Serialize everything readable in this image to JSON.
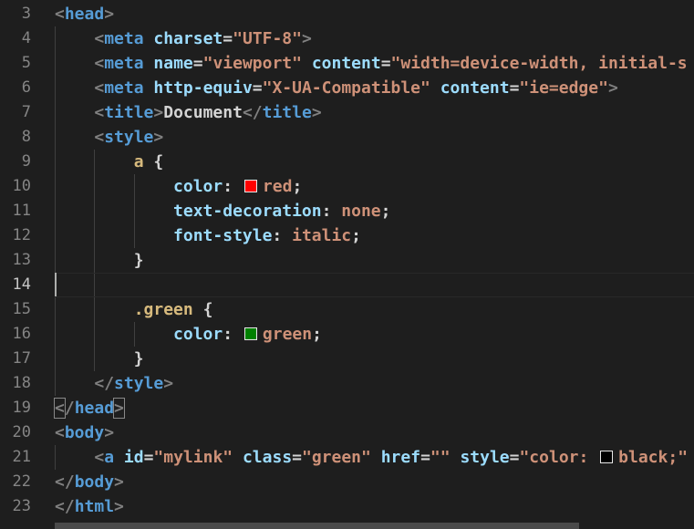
{
  "editor": {
    "lines": [
      {
        "no": "3",
        "code": [
          {
            "t": "punc",
            "v": "<"
          },
          {
            "t": "tag",
            "v": "head"
          },
          {
            "t": "punc",
            "v": ">"
          }
        ]
      },
      {
        "no": "4",
        "code": [
          {
            "t": "text",
            "v": "    "
          },
          {
            "t": "punc",
            "v": "<"
          },
          {
            "t": "tag",
            "v": "meta"
          },
          {
            "t": "text",
            "v": " "
          },
          {
            "t": "attr",
            "v": "charset"
          },
          {
            "t": "text",
            "v": "="
          },
          {
            "t": "str",
            "v": "\"UTF-8\""
          },
          {
            "t": "punc",
            "v": ">"
          }
        ]
      },
      {
        "no": "5",
        "code": [
          {
            "t": "text",
            "v": "    "
          },
          {
            "t": "punc",
            "v": "<"
          },
          {
            "t": "tag",
            "v": "meta"
          },
          {
            "t": "text",
            "v": " "
          },
          {
            "t": "attr",
            "v": "name"
          },
          {
            "t": "text",
            "v": "="
          },
          {
            "t": "str",
            "v": "\"viewport\""
          },
          {
            "t": "text",
            "v": " "
          },
          {
            "t": "attr",
            "v": "content"
          },
          {
            "t": "text",
            "v": "="
          },
          {
            "t": "str",
            "v": "\"width=device-width, initial-s"
          }
        ]
      },
      {
        "no": "6",
        "code": [
          {
            "t": "text",
            "v": "    "
          },
          {
            "t": "punc",
            "v": "<"
          },
          {
            "t": "tag",
            "v": "meta"
          },
          {
            "t": "text",
            "v": " "
          },
          {
            "t": "attr",
            "v": "http-equiv"
          },
          {
            "t": "text",
            "v": "="
          },
          {
            "t": "str",
            "v": "\"X-UA-Compatible\""
          },
          {
            "t": "text",
            "v": " "
          },
          {
            "t": "attr",
            "v": "content"
          },
          {
            "t": "text",
            "v": "="
          },
          {
            "t": "str",
            "v": "\"ie=edge\""
          },
          {
            "t": "punc",
            "v": ">"
          }
        ]
      },
      {
        "no": "7",
        "code": [
          {
            "t": "text",
            "v": "    "
          },
          {
            "t": "punc",
            "v": "<"
          },
          {
            "t": "tag",
            "v": "title"
          },
          {
            "t": "punc",
            "v": ">"
          },
          {
            "t": "text",
            "v": "Document"
          },
          {
            "t": "punc",
            "v": "</"
          },
          {
            "t": "tag",
            "v": "title"
          },
          {
            "t": "punc",
            "v": ">"
          }
        ]
      },
      {
        "no": "8",
        "code": [
          {
            "t": "text",
            "v": "    "
          },
          {
            "t": "punc",
            "v": "<"
          },
          {
            "t": "tag",
            "v": "style"
          },
          {
            "t": "punc",
            "v": ">"
          }
        ]
      },
      {
        "no": "9",
        "code": [
          {
            "t": "text",
            "v": "        "
          },
          {
            "t": "sel",
            "v": "a"
          },
          {
            "t": "text",
            "v": " {"
          }
        ]
      },
      {
        "no": "10",
        "code": [
          {
            "t": "text",
            "v": "            "
          },
          {
            "t": "prop",
            "v": "color"
          },
          {
            "t": "text",
            "v": ": "
          },
          {
            "t": "swatch",
            "v": "#ff0000"
          },
          {
            "t": "val",
            "v": "red"
          },
          {
            "t": "text",
            "v": ";"
          }
        ]
      },
      {
        "no": "11",
        "code": [
          {
            "t": "text",
            "v": "            "
          },
          {
            "t": "prop",
            "v": "text-decoration"
          },
          {
            "t": "text",
            "v": ": "
          },
          {
            "t": "val",
            "v": "none"
          },
          {
            "t": "text",
            "v": ";"
          }
        ]
      },
      {
        "no": "12",
        "code": [
          {
            "t": "text",
            "v": "            "
          },
          {
            "t": "prop",
            "v": "font-style"
          },
          {
            "t": "text",
            "v": ": "
          },
          {
            "t": "val",
            "v": "italic"
          },
          {
            "t": "text",
            "v": ";"
          }
        ]
      },
      {
        "no": "13",
        "code": [
          {
            "t": "text",
            "v": "        }"
          }
        ]
      },
      {
        "no": "14",
        "code": []
      },
      {
        "no": "15",
        "code": [
          {
            "t": "text",
            "v": "        "
          },
          {
            "t": "sel",
            "v": ".green"
          },
          {
            "t": "text",
            "v": " {"
          }
        ]
      },
      {
        "no": "16",
        "code": [
          {
            "t": "text",
            "v": "            "
          },
          {
            "t": "prop",
            "v": "color"
          },
          {
            "t": "text",
            "v": ": "
          },
          {
            "t": "swatch",
            "v": "#008000"
          },
          {
            "t": "val",
            "v": "green"
          },
          {
            "t": "text",
            "v": ";"
          }
        ]
      },
      {
        "no": "17",
        "code": [
          {
            "t": "text",
            "v": "        }"
          }
        ]
      },
      {
        "no": "18",
        "code": [
          {
            "t": "text",
            "v": "    "
          },
          {
            "t": "punc",
            "v": "</"
          },
          {
            "t": "tag",
            "v": "style"
          },
          {
            "t": "punc",
            "v": ">"
          }
        ]
      },
      {
        "no": "19",
        "code": [
          {
            "t": "punc",
            "v": "<",
            "match": true
          },
          {
            "t": "punc",
            "v": "/"
          },
          {
            "t": "tag",
            "v": "head"
          },
          {
            "t": "punc",
            "v": ">",
            "match": true
          }
        ]
      },
      {
        "no": "20",
        "code": [
          {
            "t": "punc",
            "v": "<"
          },
          {
            "t": "tag",
            "v": "body"
          },
          {
            "t": "punc",
            "v": ">"
          }
        ]
      },
      {
        "no": "21",
        "code": [
          {
            "t": "text",
            "v": "    "
          },
          {
            "t": "punc",
            "v": "<"
          },
          {
            "t": "tag",
            "v": "a"
          },
          {
            "t": "text",
            "v": " "
          },
          {
            "t": "attr",
            "v": "id"
          },
          {
            "t": "text",
            "v": "="
          },
          {
            "t": "str",
            "v": "\"mylink\""
          },
          {
            "t": "text",
            "v": " "
          },
          {
            "t": "attr",
            "v": "class"
          },
          {
            "t": "text",
            "v": "="
          },
          {
            "t": "str",
            "v": "\"green\""
          },
          {
            "t": "text",
            "v": " "
          },
          {
            "t": "attr",
            "v": "href"
          },
          {
            "t": "text",
            "v": "="
          },
          {
            "t": "str",
            "v": "\"\""
          },
          {
            "t": "text",
            "v": " "
          },
          {
            "t": "attr",
            "v": "style"
          },
          {
            "t": "text",
            "v": "="
          },
          {
            "t": "str",
            "v": "\"color: "
          },
          {
            "t": "swatch",
            "v": "#000000"
          },
          {
            "t": "str",
            "v": "black;\""
          }
        ]
      },
      {
        "no": "22",
        "code": [
          {
            "t": "punc",
            "v": "</"
          },
          {
            "t": "tag",
            "v": "body"
          },
          {
            "t": "punc",
            "v": ">"
          }
        ]
      },
      {
        "no": "23",
        "code": [
          {
            "t": "punc",
            "v": "</"
          },
          {
            "t": "tag",
            "v": "html"
          },
          {
            "t": "punc",
            "v": ">"
          }
        ]
      }
    ],
    "active_line": "14"
  }
}
